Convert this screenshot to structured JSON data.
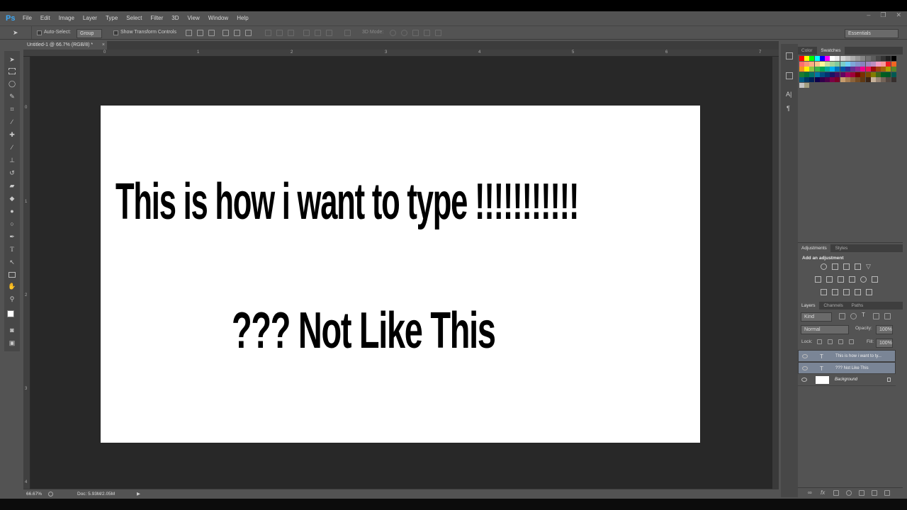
{
  "menu": {
    "logo": "Ps",
    "items": [
      "File",
      "Edit",
      "Image",
      "Layer",
      "Type",
      "Select",
      "Filter",
      "3D",
      "View",
      "Window",
      "Help"
    ]
  },
  "window_controls": {
    "minimize": "–",
    "restore": "❐",
    "close": "✕"
  },
  "options_bar": {
    "auto_select_label": "Auto-Select:",
    "auto_select_value": "Group",
    "show_transform_label": "Show Transform Controls",
    "mode_3d_label": "3D Mode:",
    "workspace_value": "Essentials"
  },
  "document_tab": {
    "title": "Untitled-1 @ 66.7% (RGB/8) *",
    "close": "×"
  },
  "ruler_h_labels": [
    "0",
    "1",
    "2",
    "3",
    "4",
    "5",
    "6",
    "7"
  ],
  "ruler_v_labels": [
    "0",
    "1",
    "2",
    "3",
    "4"
  ],
  "canvas": {
    "line1": "This is how i want to type !!!!!!!!!!!",
    "line2": "??? Not Like This"
  },
  "status": {
    "zoom": "66.67%",
    "doc_info": "Doc: 5.93M/2.05M"
  },
  "color_panel": {
    "tabs": [
      "Color",
      "Swatches"
    ],
    "active": "Swatches"
  },
  "adjustments_panel": {
    "tabs": [
      "Adjustments",
      "Styles"
    ],
    "active": "Adjustments",
    "title": "Add an adjustment"
  },
  "layers_panel": {
    "tabs": [
      "Layers",
      "Channels",
      "Paths"
    ],
    "active": "Layers",
    "kind_label": "Kind",
    "blend_mode": "Normal",
    "opacity_label": "Opacity:",
    "opacity_value": "100%",
    "lock_label": "Lock:",
    "fill_label": "Fill:",
    "fill_value": "100%",
    "layers": [
      {
        "name": "This is how i want to ty...",
        "type": "text",
        "selected": true
      },
      {
        "name": "??? Not Like This",
        "type": "text",
        "selected": true
      },
      {
        "name": "Background",
        "type": "raster",
        "selected": false
      }
    ]
  },
  "tools": [
    "move-tool",
    "marquee-tool",
    "lasso-tool",
    "quick-select-tool",
    "crop-tool",
    "eyedropper-tool",
    "healing-brush-tool",
    "brush-tool",
    "clone-stamp-tool",
    "history-brush-tool",
    "eraser-tool",
    "paint-bucket-tool",
    "blur-tool",
    "dodge-tool",
    "pen-tool",
    "type-tool",
    "path-select-tool",
    "rectangle-tool",
    "hand-tool",
    "zoom-tool"
  ],
  "swatch_colors": [
    "#ff0000",
    "#ffff00",
    "#00ff00",
    "#00ffff",
    "#0000ff",
    "#ff00ff",
    "#ffffff",
    "#ebebeb",
    "#d6d6d6",
    "#c2c2c2",
    "#adadad",
    "#999999",
    "#858585",
    "#707070",
    "#5c5c5c",
    "#474747",
    "#333333",
    "#1f1f1f",
    "#000000",
    "#ff6e6e",
    "#f7977a",
    "#fbad82",
    "#fdc68a",
    "#fff79a",
    "#c4df9b",
    "#a3d39c",
    "#82ca9d",
    "#7bcdc8",
    "#6ecff6",
    "#7ea7d8",
    "#8493ca",
    "#8882be",
    "#a187be",
    "#bc8dbf",
    "#f49ac2",
    "#f6989d",
    "#ed1c24",
    "#f26522",
    "#f7941d",
    "#fff200",
    "#8dc73f",
    "#39b54a",
    "#00a651",
    "#00a99d",
    "#00aeef",
    "#0072bc",
    "#0054a6",
    "#2e3192",
    "#662d91",
    "#92278f",
    "#ec008c",
    "#ed145b",
    "#9e0b0f",
    "#a0410d",
    "#a36209",
    "#aba000",
    "#598527",
    "#1a7b30",
    "#007236",
    "#00746b",
    "#0076a3",
    "#004b80",
    "#003471",
    "#1b1464",
    "#440e62",
    "#630460",
    "#9e005d",
    "#9e0039",
    "#790000",
    "#7b2e00",
    "#7d4900",
    "#827b00",
    "#406618",
    "#005e20",
    "#005826",
    "#005952",
    "#005b7f",
    "#003663",
    "#002157",
    "#0d004c",
    "#32004b",
    "#4b0049",
    "#7b0046",
    "#7a0026",
    "#c69c6d",
    "#a67c52",
    "#8c6239",
    "#754c24",
    "#603913",
    "#3c2415",
    "#c7b299",
    "#998675",
    "#736357",
    "#534741",
    "#362f2d",
    "#c3c3c3",
    "#a39e80"
  ]
}
